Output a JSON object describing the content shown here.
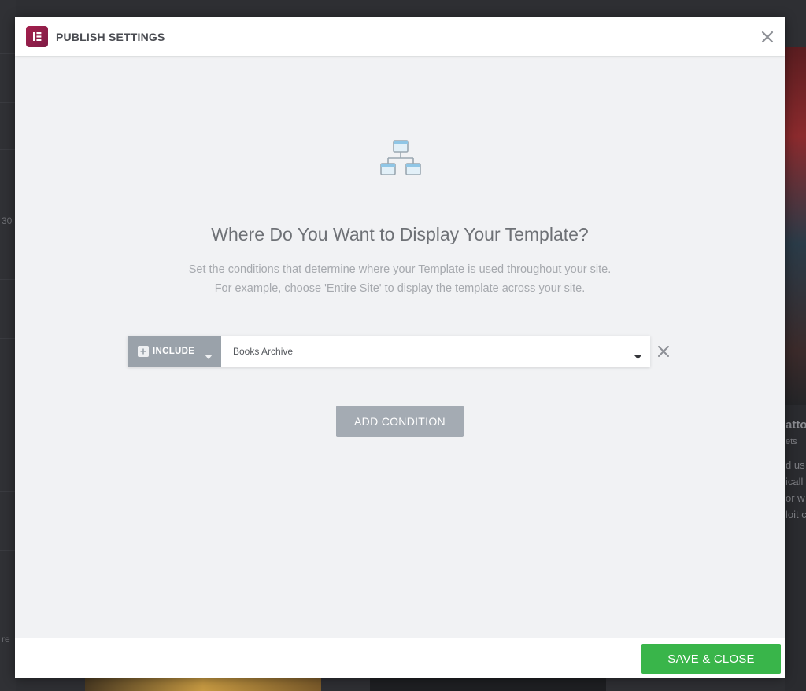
{
  "background_fragments": {
    "left_number": "30",
    "left_letter": "re",
    "right_line1": "atto",
    "right_line2": "ets",
    "right_line3": "d us",
    "right_line4": "icall",
    "right_line5": "or w",
    "right_line6": "loit c"
  },
  "modal": {
    "title": "PUBLISH SETTINGS",
    "close_icon": "close-icon",
    "logo_icon": "elementor-logo"
  },
  "content": {
    "icon": "sitemap-icon",
    "heading": "Where Do You Want to Display Your Template?",
    "description_line1": "Set the conditions that determine where your Template is used throughout your site.",
    "description_line2": "For example, choose 'Entire Site' to display the template across your site."
  },
  "condition": {
    "type_label": "INCLUDE",
    "value": "Books Archive"
  },
  "buttons": {
    "add_condition": "ADD CONDITION",
    "save_close": "SAVE & CLOSE"
  },
  "colors": {
    "save_green": "#39b54a",
    "include_gray": "#9aa2aa",
    "logo_crimson": "#92003b"
  }
}
